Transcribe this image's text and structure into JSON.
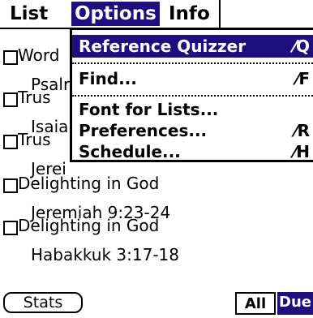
{
  "menubar": {
    "list": "List",
    "options": "Options",
    "info": "Info"
  },
  "rows": [
    {
      "title": "Word",
      "ref": "Psalr"
    },
    {
      "title": "Trus",
      "ref": "Isaial"
    },
    {
      "title": "Trus",
      "ref": "Jerei"
    },
    {
      "title": "Delighting in God",
      "ref": "Jeremiah 9:23-24"
    },
    {
      "title": "Delighting in God",
      "ref": "Habakkuk 3:17-18"
    }
  ],
  "menu": {
    "items": [
      {
        "label": "Reference Quizzer",
        "shortcut": "⁄Q"
      },
      {
        "label": "Find...",
        "shortcut": "⁄F"
      },
      {
        "label": "Font for Lists...",
        "shortcut": ""
      },
      {
        "label": "Preferences...",
        "shortcut": "⁄R"
      },
      {
        "label": "Schedule...",
        "shortcut": "⁄H"
      }
    ]
  },
  "footer": {
    "stats": "Stats",
    "all": "All",
    "due": "Due"
  },
  "colors": {
    "highlight": "#1e0e7e"
  }
}
